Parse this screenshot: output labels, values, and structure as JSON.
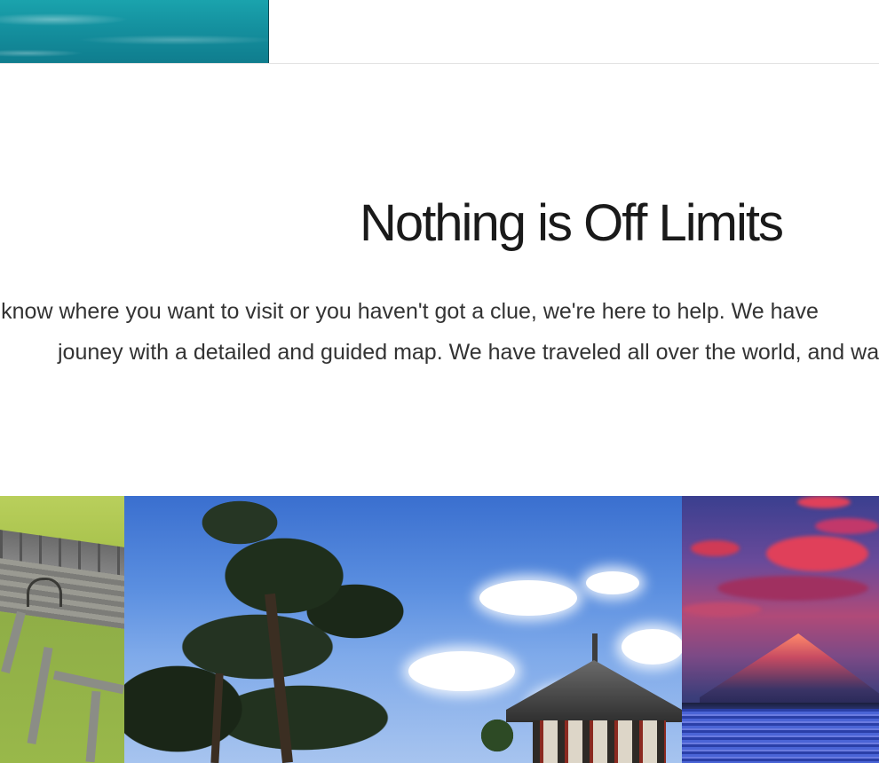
{
  "section": {
    "title": "Nothing is Off Limits",
    "body_line_1": "eady know where you want to visit or you haven't got a clue, we're here to help. We have",
    "body_line_2": "jouney with a detailed and guided map. We have traveled all over the world, and wa"
  },
  "images": {
    "top_strip": "turquoise water photo",
    "gallery": [
      "grass ruins aerial photo",
      "pine tree and temple photo",
      "mountain at sunset photo"
    ]
  },
  "colors": {
    "title": "#1a1a1a",
    "body": "#333333",
    "background": "#ffffff"
  }
}
